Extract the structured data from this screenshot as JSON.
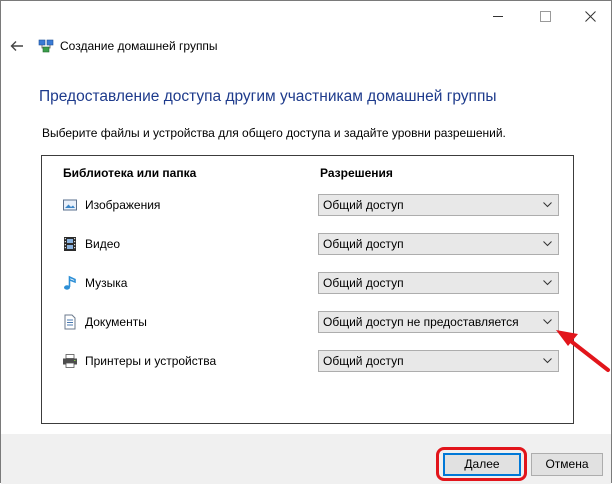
{
  "window": {
    "title": "Создание домашней группы"
  },
  "page": {
    "heading": "Предоставление доступа другим участникам домашней группы",
    "description": "Выберите файлы и устройства для общего доступа и задайте уровни разрешений."
  },
  "table": {
    "headers": {
      "library": "Библиотека или папка",
      "permissions": "Разрешения"
    },
    "rows": [
      {
        "label": "Изображения",
        "icon": "pictures-icon",
        "permission": "Общий доступ"
      },
      {
        "label": "Видео",
        "icon": "videos-icon",
        "permission": "Общий доступ"
      },
      {
        "label": "Музыка",
        "icon": "music-icon",
        "permission": "Общий доступ"
      },
      {
        "label": "Документы",
        "icon": "documents-icon",
        "permission": "Общий доступ не предоставляется"
      },
      {
        "label": "Принтеры и устройства",
        "icon": "printer-icon",
        "permission": "Общий доступ"
      }
    ]
  },
  "buttons": {
    "next": "Далее",
    "cancel": "Отмена"
  },
  "colors": {
    "heading": "#1e3b8c",
    "annotation": "#e2151b",
    "focus": "#0078d7"
  }
}
